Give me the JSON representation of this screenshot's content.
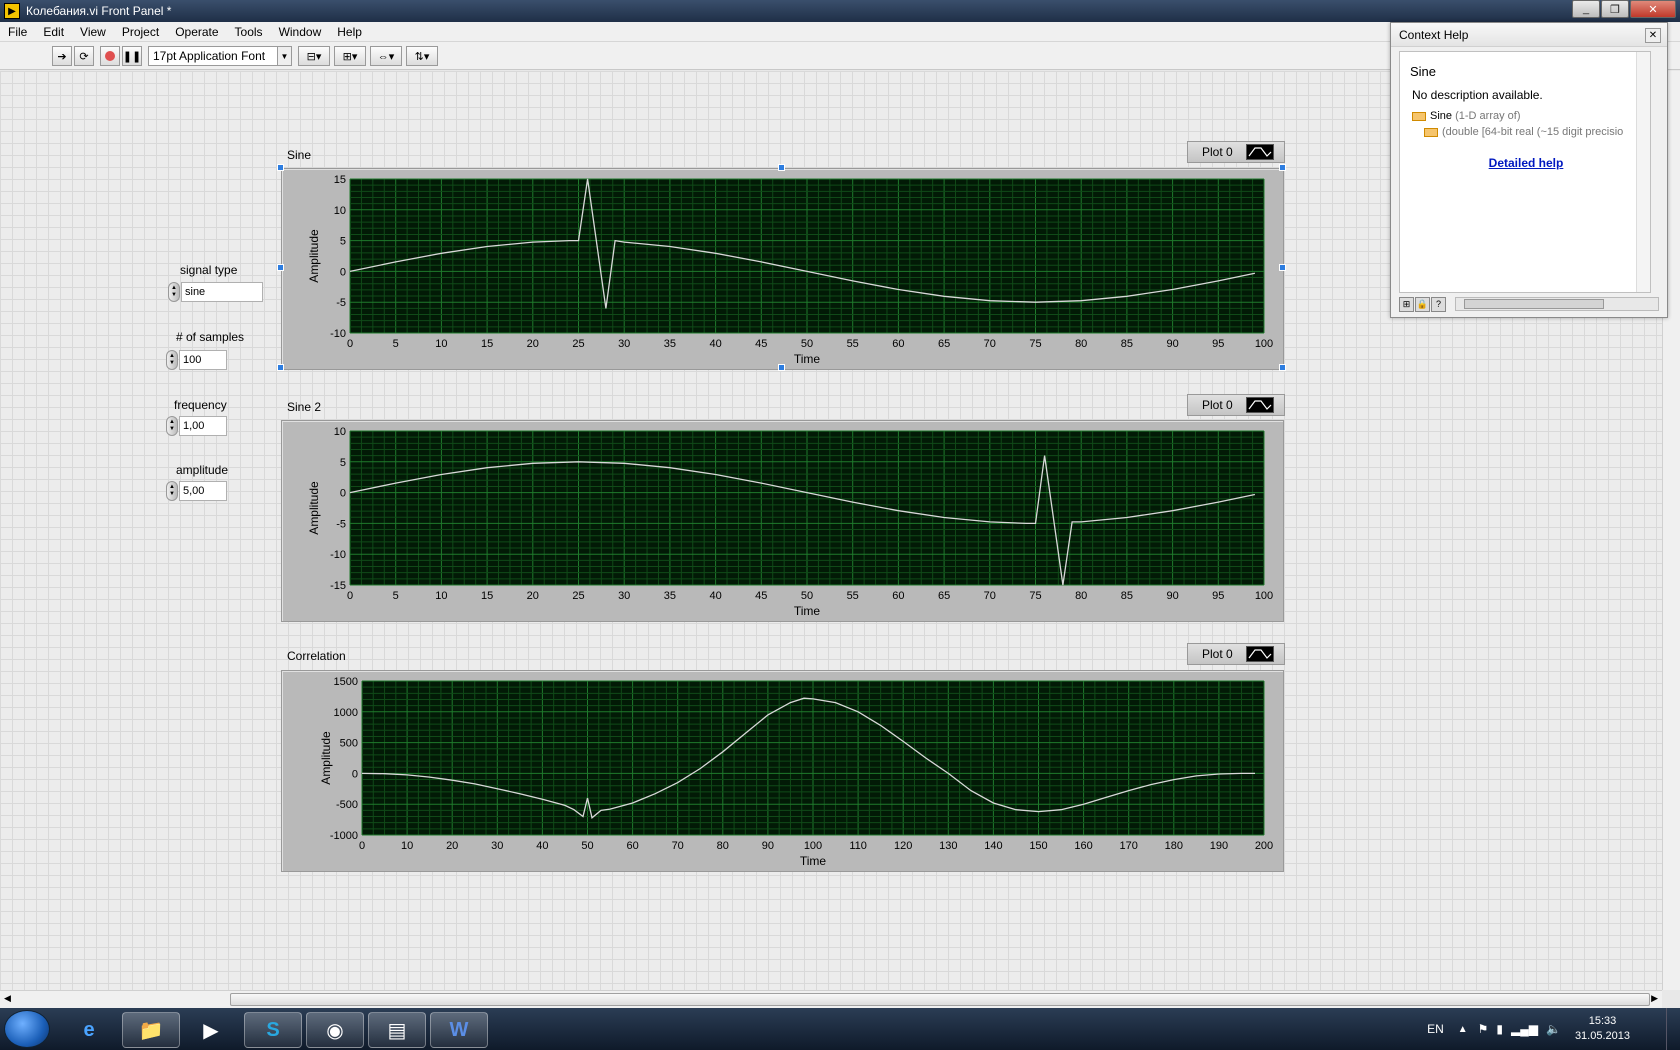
{
  "window": {
    "title": "Колебания.vi Front Panel *"
  },
  "menu": [
    "File",
    "Edit",
    "View",
    "Project",
    "Operate",
    "Tools",
    "Window",
    "Help"
  ],
  "toolbar": {
    "font": "17pt Application Font"
  },
  "controls": {
    "signal_type": {
      "label": "signal type",
      "value": "sine"
    },
    "samples": {
      "label": "# of samples",
      "value": "100"
    },
    "frequency": {
      "label": "frequency",
      "value": "1,00"
    },
    "amplitude": {
      "label": "amplitude",
      "value": "5,00"
    }
  },
  "graphs": [
    {
      "title": "Sine",
      "legend": "Plot 0",
      "xlabel": "Time",
      "ylabel": "Amplitude"
    },
    {
      "title": "Sine 2",
      "legend": "Plot 0",
      "xlabel": "Time",
      "ylabel": "Amplitude"
    },
    {
      "title": "Correlation",
      "legend": "Plot 0",
      "xlabel": "Time",
      "ylabel": "Amplitude"
    }
  ],
  "chart_data": [
    {
      "type": "line",
      "title": "Sine",
      "xlabel": "Time",
      "ylabel": "Amplitude",
      "xlim": [
        0,
        100
      ],
      "ylim": [
        -10,
        15
      ],
      "xticks": [
        0,
        5,
        10,
        15,
        20,
        25,
        30,
        35,
        40,
        45,
        50,
        55,
        60,
        65,
        70,
        75,
        80,
        85,
        90,
        95,
        100
      ],
      "yticks": [
        15,
        10,
        5,
        0,
        -5,
        -10
      ],
      "grid": true,
      "series": [
        {
          "name": "Plot 0",
          "color": "#d8d8d8",
          "x": [
            0,
            5,
            10,
            15,
            20,
            24,
            25,
            26,
            28,
            29,
            30,
            35,
            40,
            45,
            50,
            55,
            60,
            65,
            70,
            75,
            80,
            85,
            90,
            95,
            99
          ],
          "y": [
            0,
            1.55,
            2.94,
            4.05,
            4.76,
            5,
            5,
            15,
            -6,
            5,
            4.76,
            4.05,
            2.94,
            1.55,
            0,
            -1.55,
            -2.94,
            -4.05,
            -4.76,
            -5,
            -4.76,
            -4.05,
            -2.94,
            -1.55,
            -0.31
          ]
        }
      ]
    },
    {
      "type": "line",
      "title": "Sine 2",
      "xlabel": "Time",
      "ylabel": "Amplitude",
      "xlim": [
        0,
        100
      ],
      "ylim": [
        -15,
        10
      ],
      "xticks": [
        0,
        5,
        10,
        15,
        20,
        25,
        30,
        35,
        40,
        45,
        50,
        55,
        60,
        65,
        70,
        75,
        80,
        85,
        90,
        95,
        100
      ],
      "yticks": [
        10,
        5,
        0,
        -5,
        -10,
        -15
      ],
      "grid": true,
      "series": [
        {
          "name": "Plot 0",
          "color": "#d8d8d8",
          "x": [
            0,
            5,
            10,
            15,
            20,
            25,
            30,
            35,
            40,
            45,
            50,
            55,
            60,
            65,
            70,
            74,
            75,
            76,
            78,
            79,
            80,
            85,
            90,
            95,
            99
          ],
          "y": [
            0,
            1.55,
            2.94,
            4.05,
            4.76,
            5,
            4.76,
            4.05,
            2.94,
            1.55,
            0,
            -1.55,
            -2.94,
            -4.05,
            -4.76,
            -5,
            -5,
            6,
            -15,
            -4.76,
            -4.76,
            -4.05,
            -2.94,
            -1.55,
            -0.31
          ]
        }
      ]
    },
    {
      "type": "line",
      "title": "Correlation",
      "xlabel": "Time",
      "ylabel": "Amplitude",
      "xlim": [
        0,
        200
      ],
      "ylim": [
        -1000,
        1500
      ],
      "xticks": [
        0,
        10,
        20,
        30,
        40,
        50,
        60,
        70,
        80,
        90,
        100,
        110,
        120,
        130,
        140,
        150,
        160,
        170,
        180,
        190,
        200
      ],
      "yticks": [
        1500,
        1000,
        500,
        0,
        -500,
        -1000
      ],
      "grid": true,
      "series": [
        {
          "name": "Plot 0",
          "color": "#d8d8d8",
          "x": [
            0,
            5,
            10,
            15,
            20,
            25,
            30,
            35,
            40,
            45,
            47,
            49,
            50,
            51,
            53,
            55,
            60,
            65,
            70,
            75,
            80,
            85,
            90,
            95,
            98,
            100,
            105,
            110,
            115,
            120,
            125,
            130,
            135,
            140,
            145,
            150,
            155,
            160,
            165,
            170,
            175,
            180,
            185,
            190,
            195,
            198
          ],
          "y": [
            0,
            -5,
            -25,
            -60,
            -110,
            -170,
            -250,
            -330,
            -420,
            -520,
            -590,
            -700,
            -400,
            -720,
            -600,
            -580,
            -480,
            -330,
            -150,
            80,
            350,
            650,
            950,
            1150,
            1220,
            1210,
            1150,
            1000,
            780,
            520,
            250,
            0,
            -280,
            -480,
            -590,
            -620,
            -590,
            -500,
            -390,
            -280,
            -180,
            -100,
            -40,
            -10,
            0,
            0
          ]
        }
      ]
    }
  ],
  "context_help": {
    "title": "Context Help",
    "heading": "Sine",
    "description": "No description available.",
    "type_line1_name": "Sine",
    "type_line1_detail": "(1-D array of)",
    "type_line2": "(double [64-bit real (~15 digit precisio",
    "link": "Detailed help"
  },
  "taskbar": {
    "lang": "EN",
    "time": "15:33",
    "date": "31.05.2013"
  }
}
